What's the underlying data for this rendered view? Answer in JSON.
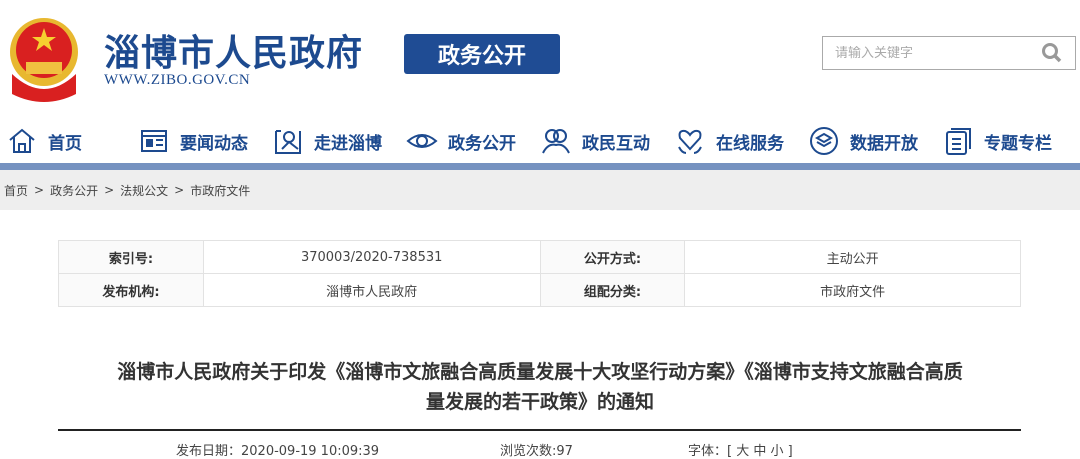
{
  "header": {
    "site_title": "淄博市人民政府",
    "site_url": "WWW.ZIBO.GOV.CN",
    "section_badge": "政务公开",
    "search_placeholder": "请输入关键字"
  },
  "nav": [
    {
      "label": "首页",
      "icon": "home-icon"
    },
    {
      "label": "要闻动态",
      "icon": "news-icon"
    },
    {
      "label": "走进淄博",
      "icon": "map-pin-icon"
    },
    {
      "label": "政务公开",
      "icon": "eye-icon"
    },
    {
      "label": "政民互动",
      "icon": "users-icon"
    },
    {
      "label": "在线服务",
      "icon": "heart-hands-icon"
    },
    {
      "label": "数据开放",
      "icon": "layers-icon"
    },
    {
      "label": "专题专栏",
      "icon": "document-icon"
    }
  ],
  "breadcrumb": [
    "首页",
    "政务公开",
    "法规公文",
    "市政府文件"
  ],
  "breadcrumb_sep": ">",
  "info_table": {
    "index_label": "索引号:",
    "index_value": "370003/2020-738531",
    "open_label": "公开方式:",
    "open_value": "主动公开",
    "publisher_label": "发布机构:",
    "publisher_value": "淄博市人民政府",
    "category_label": "组配分类:",
    "category_value": "市政府文件"
  },
  "article": {
    "title_line1": "淄博市人民政府关于印发《淄博市文旅融合高质量发展十大攻坚行动方案》《淄博市支持文旅融合高质",
    "title_line2": "量发展的若干政策》的通知",
    "publish_date": "发布日期：2020-09-19 10:09:39",
    "views": "浏览次数:97",
    "font_size_label": "字体：[ 大 中 小 ]"
  },
  "colors": {
    "brand": "#1d4a8f",
    "badge": "#1f4c94",
    "navline": "#7592c0"
  }
}
